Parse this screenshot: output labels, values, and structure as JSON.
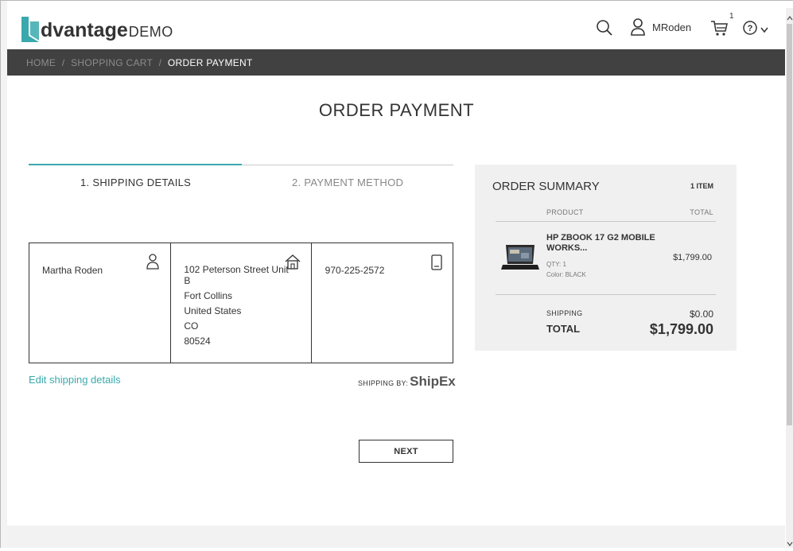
{
  "app": {
    "logo_main": "dvantage",
    "logo_sub": "DEMO",
    "logo_color": "#3aa9ad"
  },
  "header": {
    "username": "MRoden",
    "cart_count": "1",
    "icons": [
      "search-icon",
      "user-icon",
      "cart-icon",
      "help-icon",
      "chevron-down-icon"
    ]
  },
  "breadcrumb": {
    "items": [
      "HOME",
      "SHOPPING CART"
    ],
    "separator": "/",
    "current": "ORDER PAYMENT"
  },
  "page": {
    "title": "ORDER PAYMENT"
  },
  "steps": [
    {
      "label": "1. SHIPPING DETAILS",
      "active": true
    },
    {
      "label": "2. PAYMENT METHOD",
      "active": false
    }
  ],
  "shipping": {
    "name": "Martha Roden",
    "address_lines": [
      "102 Peterson Street Unit",
      "B",
      "Fort Collins",
      "United States",
      "CO",
      "80524"
    ],
    "phone": "970-225-2572",
    "edit_link": "Edit shipping details",
    "shipping_by_label": "SHIPPING BY:",
    "shipping_by_logo": "ShipEx",
    "next_button": "NEXT"
  },
  "order_summary": {
    "title": "ORDER SUMMARY",
    "item_count": "1 ITEM",
    "col_product": "PRODUCT",
    "col_total": "TOTAL",
    "product": {
      "name": "HP ZBOOK 17 G2 MOBILE WORKS...",
      "qty": "QTY: 1",
      "color": "Color: BLACK",
      "price": "$1,799.00"
    },
    "shipping_label": "SHIPPING",
    "shipping_value": "$0.00",
    "total_label": "TOTAL",
    "total_value": "$1,799.00"
  },
  "colors": {
    "accent": "#3aa9ad",
    "breadcrumb_bg": "#414141",
    "summary_bg": "#f0f0f0"
  }
}
